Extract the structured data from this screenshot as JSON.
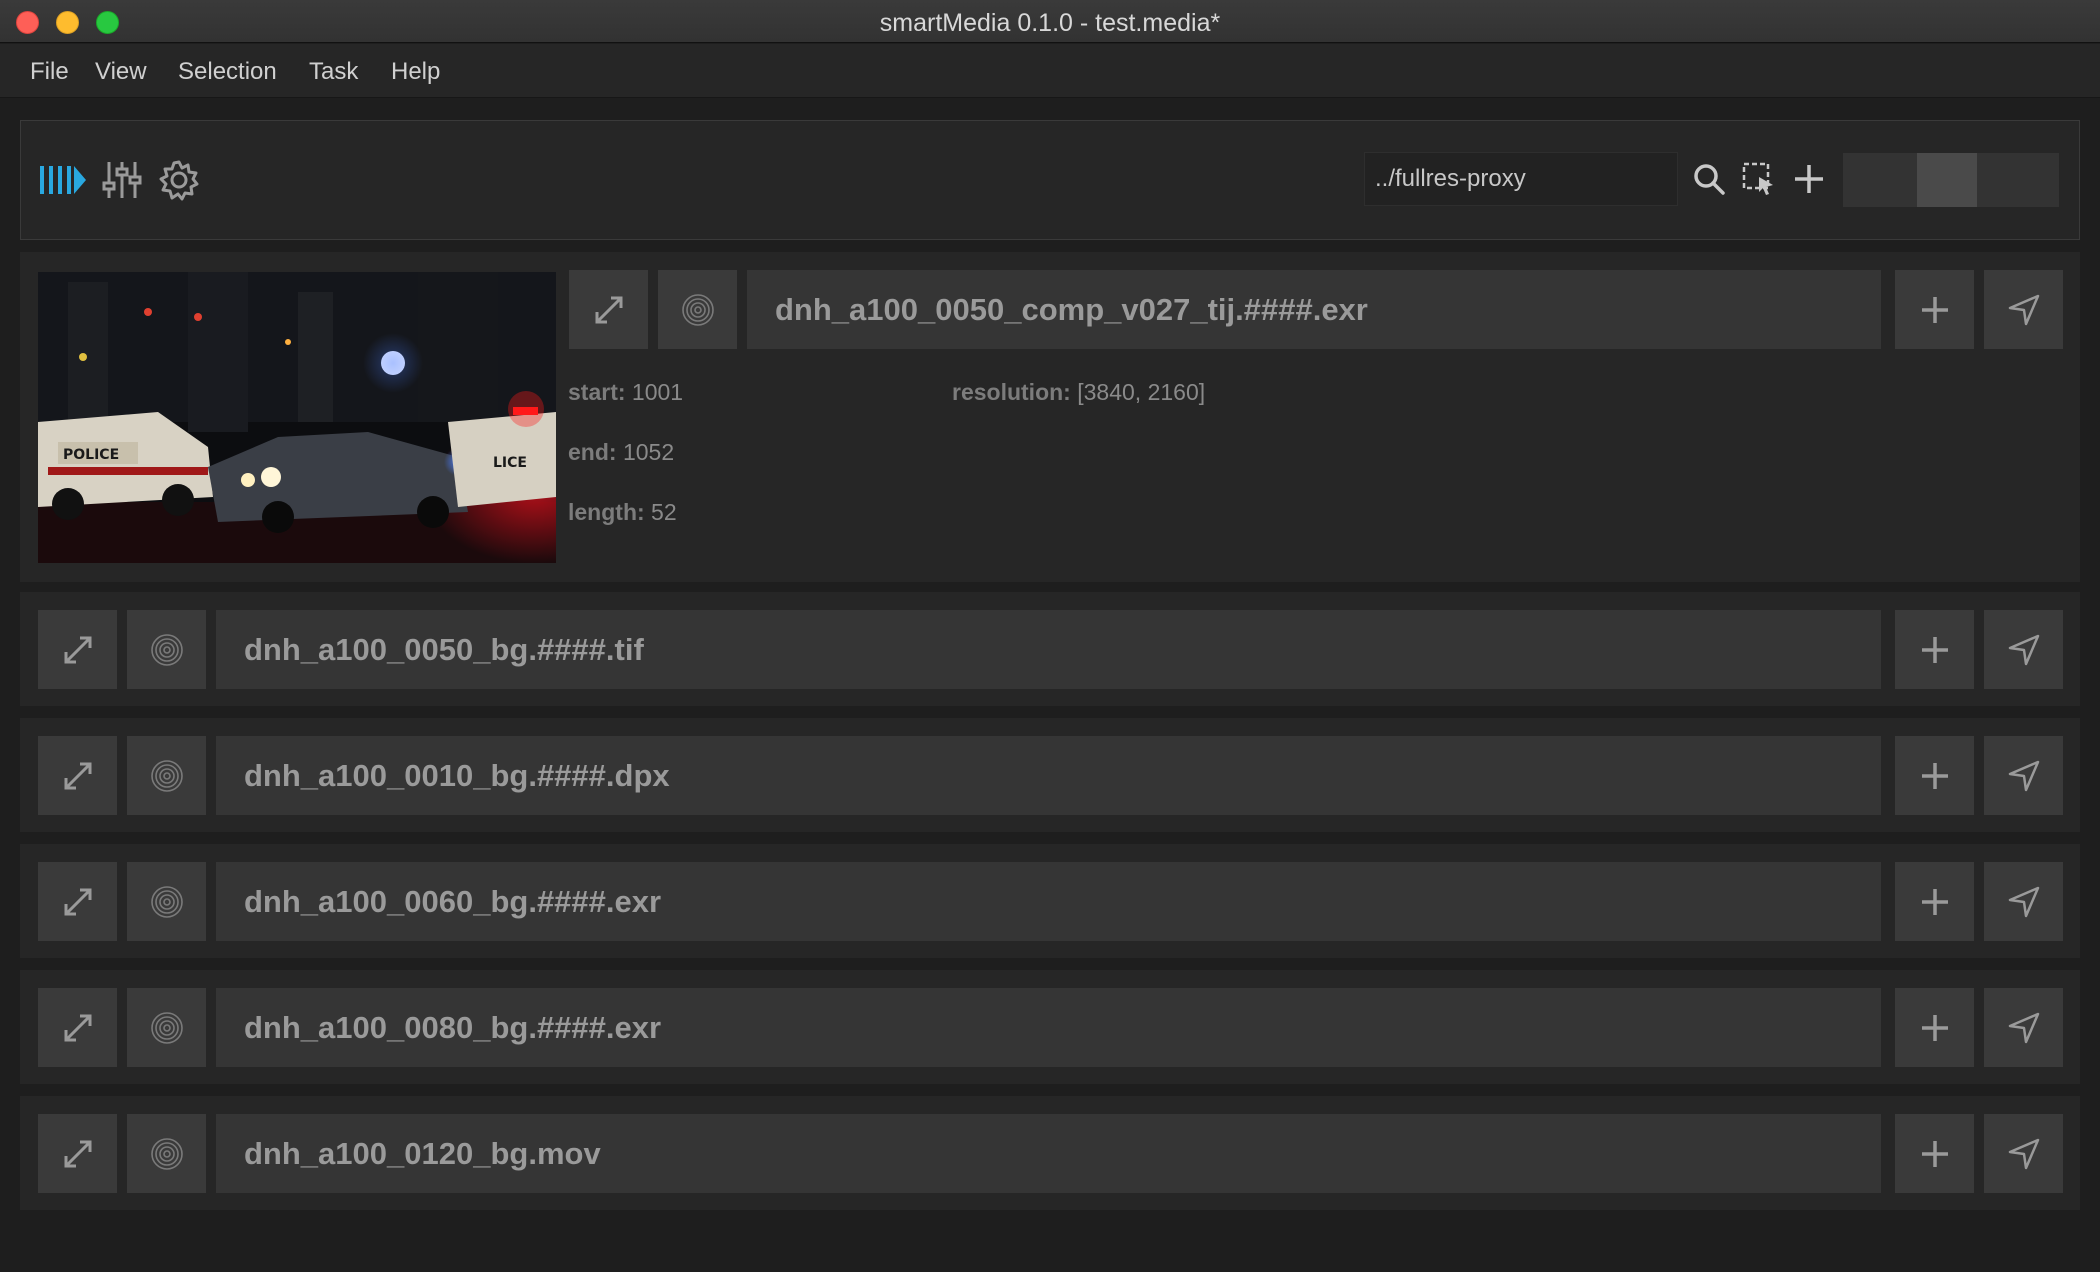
{
  "window": {
    "title": "smartMedia 0.1.0 - test.media*"
  },
  "menu": [
    "File",
    "View",
    "Selection",
    "Task",
    "Help"
  ],
  "toolbar": {
    "path_value": "../fullres-proxy",
    "icons": [
      "play-bars-icon",
      "sliders-icon",
      "gear-icon",
      "search-icon",
      "select-cursor-icon",
      "plus-icon"
    ],
    "accent_color": "#29a8e0"
  },
  "items": [
    {
      "name": "dnh_a100_0050_comp_v027_tij.####.exr",
      "expanded": true,
      "start_label": "start:",
      "start": "1001",
      "end_label": "end:",
      "end": "1052",
      "length_label": "length:",
      "length": "52",
      "resolution_label": "resolution:",
      "resolution": "[3840, 2160]"
    },
    {
      "name": "dnh_a100_0050_bg.####.tif"
    },
    {
      "name": "dnh_a100_0010_bg.####.dpx"
    },
    {
      "name": "dnh_a100_0060_bg.####.exr"
    },
    {
      "name": "dnh_a100_0080_bg.####.exr"
    },
    {
      "name": "dnh_a100_0120_bg.mov"
    }
  ]
}
